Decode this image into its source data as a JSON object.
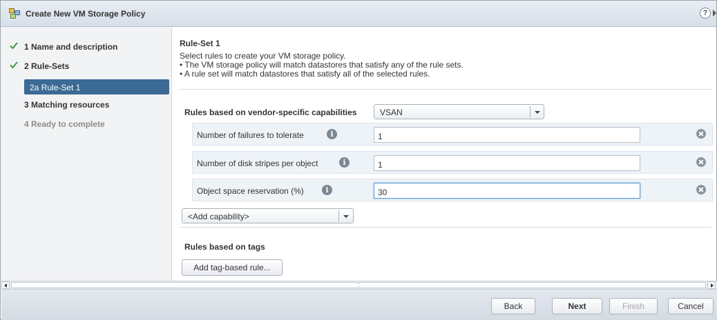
{
  "window": {
    "title": "Create New VM Storage Policy",
    "help_label": "?"
  },
  "nav": {
    "items": [
      {
        "label": "1  Name and description",
        "state": "done"
      },
      {
        "label": "2  Rule-Sets",
        "state": "done"
      },
      {
        "label": "2a  Rule-Set 1",
        "state": "selected"
      },
      {
        "label": "3  Matching resources",
        "state": "pending"
      },
      {
        "label": "4  Ready to complete",
        "state": "disabled"
      }
    ]
  },
  "ruleset": {
    "title": "Rule-Set 1",
    "description": "Select rules to create your VM storage policy.",
    "bullet1": "• The VM storage policy will match datastores that satisfy any of the rule sets.",
    "bullet2": "• A rule set will match datastores that satisfy all of the selected rules.",
    "vendor_label": "Rules based on vendor-specific capabilities",
    "vendor_value": "VSAN",
    "rules": [
      {
        "label": "Number of failures to tolerate",
        "value": "1"
      },
      {
        "label": "Number of disk stripes per object",
        "value": "1"
      },
      {
        "label": "Object space reservation (%)",
        "value": "30"
      }
    ],
    "add_capability": "<Add capability>",
    "tags_label": "Rules based on tags",
    "add_tag_button": "Add tag-based rule..."
  },
  "footer": {
    "back": "Back",
    "next": "Next",
    "finish": "Finish",
    "cancel": "Cancel"
  },
  "colors": {
    "check": "#3c9a3c",
    "selected_bg": "#3b6a94",
    "focus_border": "#5a9bd5"
  }
}
